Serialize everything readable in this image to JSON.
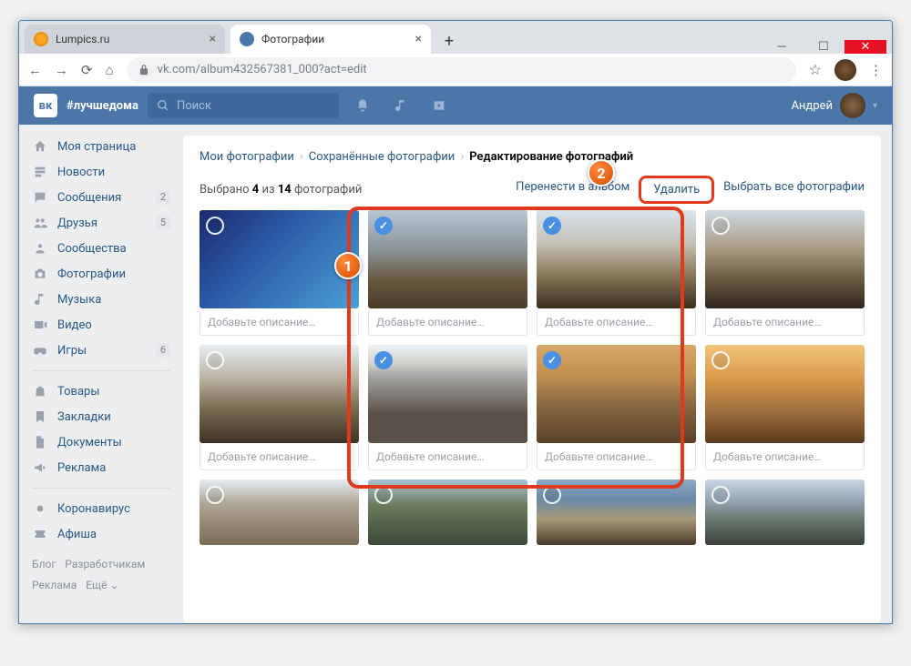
{
  "browser": {
    "tabs": [
      {
        "title": "Lumpics.ru"
      },
      {
        "title": "Фотографии"
      }
    ],
    "url": "vk.com/album432567381_000?act=edit"
  },
  "vk": {
    "logo": "вк",
    "hashtag": "#лучшедома",
    "search_placeholder": "Поиск",
    "username": "Андрей"
  },
  "sidebar": {
    "items": [
      {
        "label": "Моя страница"
      },
      {
        "label": "Новости"
      },
      {
        "label": "Сообщения",
        "badge": "2"
      },
      {
        "label": "Друзья",
        "badge": "5"
      },
      {
        "label": "Сообщества"
      },
      {
        "label": "Фотографии"
      },
      {
        "label": "Музыка"
      },
      {
        "label": "Видео"
      },
      {
        "label": "Игры",
        "badge": "6"
      }
    ],
    "items2": [
      {
        "label": "Товары"
      },
      {
        "label": "Закладки"
      },
      {
        "label": "Документы"
      },
      {
        "label": "Реклама"
      }
    ],
    "items3": [
      {
        "label": "Коронавирус"
      },
      {
        "label": "Афиша"
      }
    ],
    "footer": {
      "a": "Блог",
      "b": "Разработчикам",
      "c": "Реклама",
      "d": "Ещё ⌄"
    }
  },
  "breadcrumb": {
    "a": "Мои фотографии",
    "b": "Сохранённые фотографии",
    "c": "Редактирование фотографий"
  },
  "toolbar": {
    "selected_prefix": "Выбрано ",
    "selected_count": "4",
    "selected_mid": " из ",
    "selected_total": "14",
    "selected_suffix": " фотографий",
    "move": "Перенести в альбом",
    "delete": "Удалить",
    "select_all": "Выбрать все фотографии"
  },
  "caption_placeholder": "Добавьте описание…",
  "markers": {
    "one": "1",
    "two": "2"
  }
}
